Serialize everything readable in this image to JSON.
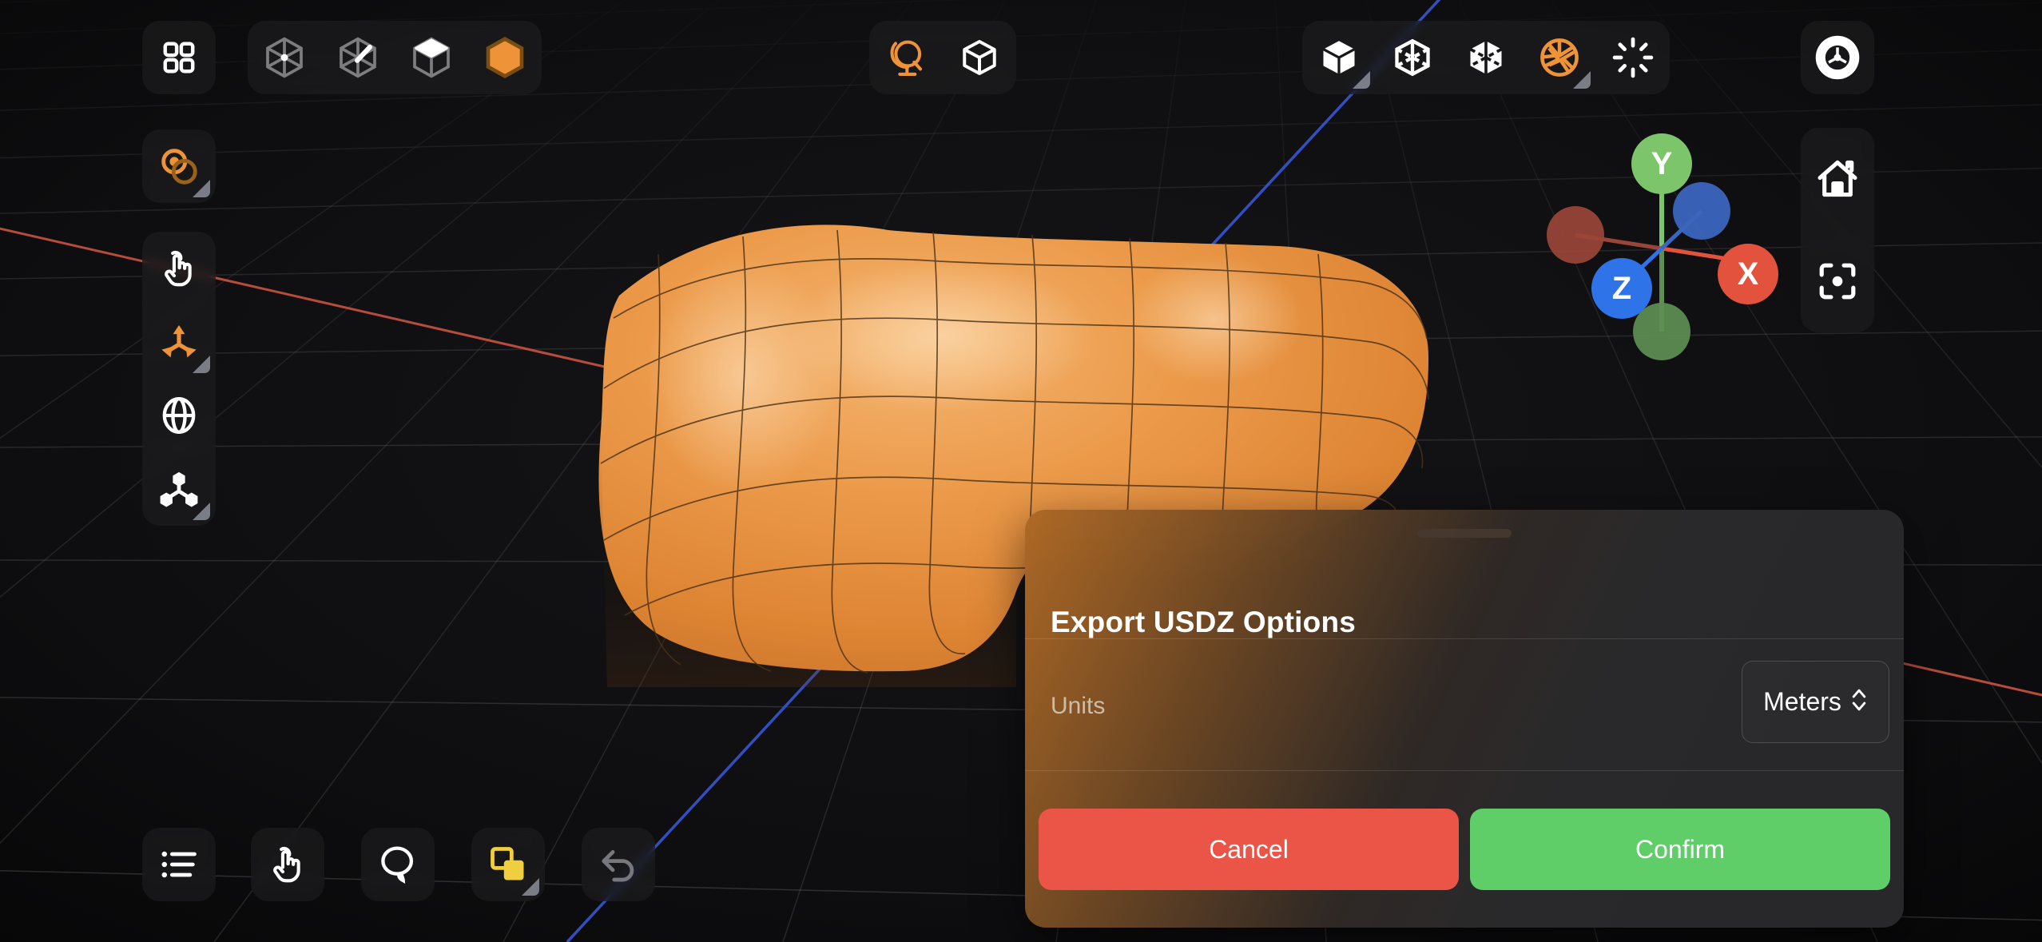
{
  "app": {
    "name": "3D Modeling Viewport",
    "background_color": "#0c0c0d",
    "accent_color": "#EE9337"
  },
  "viewport": {
    "grid_line_color": "#8a8a8a",
    "x_axis_color": "#c35442",
    "z_axis_color": "#3a56c8",
    "model": {
      "name": "rounded-box-mesh",
      "surface_color": "#E8953F",
      "wireframe_color": "#4a3118"
    }
  },
  "top_toolbar": {
    "group_apps": [
      {
        "icon": "apps-grid-icon",
        "name": "apps-grid",
        "active": false,
        "color": "#ffffff",
        "has_submenu": false
      }
    ],
    "group_primitives": [
      {
        "icon": "vertex-point-icon",
        "name": "vertex-mode",
        "active": false,
        "color": "#7d7d80",
        "has_submenu": false
      },
      {
        "icon": "edge-line-icon",
        "name": "edge-mode",
        "active": false,
        "color": "#7d7d80",
        "has_submenu": false
      },
      {
        "icon": "face-top-icon",
        "name": "face-mode",
        "active": false,
        "color": "#ffffff",
        "has_submenu": false
      },
      {
        "icon": "hexagon-solid-icon",
        "name": "object-mode",
        "active": true,
        "color": "#EE9337",
        "has_submenu": false
      }
    ],
    "group_world": [
      {
        "icon": "globe-stand-icon",
        "name": "world-space",
        "active": true,
        "color": "#EE9337",
        "has_submenu": false
      },
      {
        "icon": "cube-outline-icon",
        "name": "local-space",
        "active": false,
        "color": "#ffffff",
        "has_submenu": false
      }
    ],
    "group_view": [
      {
        "icon": "cube-solid-icon",
        "name": "shading-solid",
        "active": false,
        "color": "#ffffff",
        "has_submenu": true
      },
      {
        "icon": "cube-wireframe-icon",
        "name": "shading-wireframe",
        "active": false,
        "color": "#ffffff",
        "has_submenu": false
      },
      {
        "icon": "cube-xray-icon",
        "name": "shading-xray",
        "active": false,
        "color": "#ffffff",
        "has_submenu": false
      },
      {
        "icon": "aperture-icon",
        "name": "camera-aperture",
        "active": true,
        "color": "#EE9337",
        "has_submenu": true
      },
      {
        "icon": "sun-rays-icon",
        "name": "lighting",
        "active": false,
        "color": "#ffffff",
        "has_submenu": false
      }
    ],
    "group_settings": [
      {
        "icon": "gear-icon",
        "name": "settings",
        "active": false,
        "color": "#ffffff",
        "has_submenu": false
      }
    ]
  },
  "left_toolbar": {
    "group_snap": [
      {
        "icon": "two-circles-snap-icon",
        "name": "snap-toggle",
        "active": true,
        "color": "#EE9337",
        "has_submenu": true
      }
    ],
    "group_tools": [
      {
        "icon": "hand-tap-icon",
        "name": "select-tool",
        "active": false,
        "color": "#ffffff",
        "has_submenu": false
      },
      {
        "icon": "move-axes-icon",
        "name": "move-tool",
        "active": true,
        "color": "#EE9337",
        "has_submenu": true
      },
      {
        "icon": "rotate-sphere-icon",
        "name": "rotate-tool",
        "active": false,
        "color": "#ffffff",
        "has_submenu": false
      },
      {
        "icon": "scale-nodes-icon",
        "name": "scale-tool",
        "active": false,
        "color": "#ffffff",
        "has_submenu": true
      }
    ]
  },
  "right_toolbar": [
    {
      "icon": "home-icon",
      "name": "reset-view",
      "active": false,
      "color": "#ffffff"
    },
    {
      "icon": "focus-target-icon",
      "name": "focus-selection",
      "active": false,
      "color": "#ffffff"
    }
  ],
  "bottom_toolbar": [
    {
      "icon": "list-bullets-icon",
      "name": "outliner",
      "active": false,
      "color": "#ffffff",
      "has_submenu": false
    },
    {
      "icon": "hand-tap-icon",
      "name": "tap-select",
      "active": false,
      "color": "#ffffff",
      "has_submenu": false
    },
    {
      "icon": "lasso-icon",
      "name": "lasso-select",
      "active": false,
      "color": "#ffffff",
      "has_submenu": false
    },
    {
      "icon": "duplicate-squares-icon",
      "name": "duplicate",
      "active": true,
      "color": "#EFCE3F",
      "has_submenu": true
    },
    {
      "icon": "undo-arrow-icon",
      "name": "undo",
      "active": false,
      "color": "#76787d",
      "has_submenu": false
    }
  ],
  "axis_gizmo": {
    "name": "view-orientation-gizmo",
    "axes": [
      {
        "label": "Y",
        "name": "axis-y-positive",
        "color": "#7DC56B",
        "filled": true
      },
      {
        "label": "",
        "name": "axis-y-negative",
        "color": "#5E8F52",
        "filled": false
      },
      {
        "label": "X",
        "name": "axis-x-positive",
        "color": "#E2523C",
        "filled": true
      },
      {
        "label": "",
        "name": "axis-x-negative",
        "color": "#9B4538",
        "filled": false
      },
      {
        "label": "Z",
        "name": "axis-z-positive",
        "color": "#2F73E8",
        "filled": true
      },
      {
        "label": "",
        "name": "axis-z-negative",
        "color": "#3C66BE",
        "filled": false
      }
    ]
  },
  "dialog": {
    "title": "Export USDZ Options",
    "rows": [
      {
        "label": "Units",
        "control": "stepper-select",
        "value": "Meters"
      }
    ],
    "buttons": [
      {
        "label": "Cancel",
        "name": "cancel-button",
        "color": "#EA5548"
      },
      {
        "label": "Confirm",
        "name": "confirm-button",
        "color": "#5FCD68"
      }
    ]
  }
}
